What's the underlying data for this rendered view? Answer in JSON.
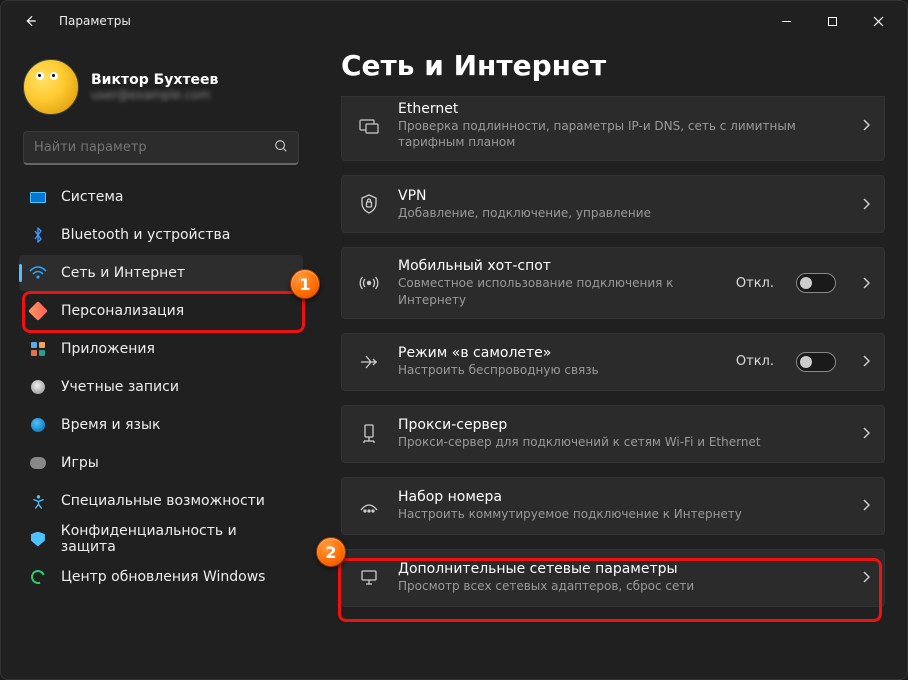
{
  "window": {
    "title": "Параметры"
  },
  "profile": {
    "name": "Виктор Бухтеев",
    "email": "user@example.com"
  },
  "search": {
    "placeholder": "Найти параметр"
  },
  "sidebar": {
    "items": [
      {
        "label": "Система"
      },
      {
        "label": "Bluetooth и устройства"
      },
      {
        "label": "Сеть и Интернет"
      },
      {
        "label": "Персонализация"
      },
      {
        "label": "Приложения"
      },
      {
        "label": "Учетные записи"
      },
      {
        "label": "Время и язык"
      },
      {
        "label": "Игры"
      },
      {
        "label": "Специальные возможности"
      },
      {
        "label": "Конфиденциальность и защита"
      },
      {
        "label": "Центр обновления Windows"
      }
    ]
  },
  "page": {
    "title": "Сеть и Интернет"
  },
  "cards": {
    "ethernet": {
      "title": "Ethernet",
      "sub": "Проверка подлинности, параметры IP-и DNS, сеть с лимитным тарифным планом"
    },
    "vpn": {
      "title": "VPN",
      "sub": "Добавление, подключение, управление"
    },
    "hotspot": {
      "title": "Мобильный хот-спот",
      "sub": "Совместное использование подключения к Интернету",
      "status": "Откл."
    },
    "airplane": {
      "title": "Режим «в самолете»",
      "sub": "Настроить беспроводную связь",
      "status": "Откл."
    },
    "proxy": {
      "title": "Прокси-сервер",
      "sub": "Прокси-сервер для подключений к сетям Wi-Fi и Ethernet"
    },
    "dialup": {
      "title": "Набор номера",
      "sub": "Настроить коммутируемое подключение к Интернету"
    },
    "advanced": {
      "title": "Дополнительные сетевые параметры",
      "sub": "Просмотр всех сетевых адаптеров, сброс сети"
    }
  },
  "annotations": {
    "badge1": "1",
    "badge2": "2"
  }
}
